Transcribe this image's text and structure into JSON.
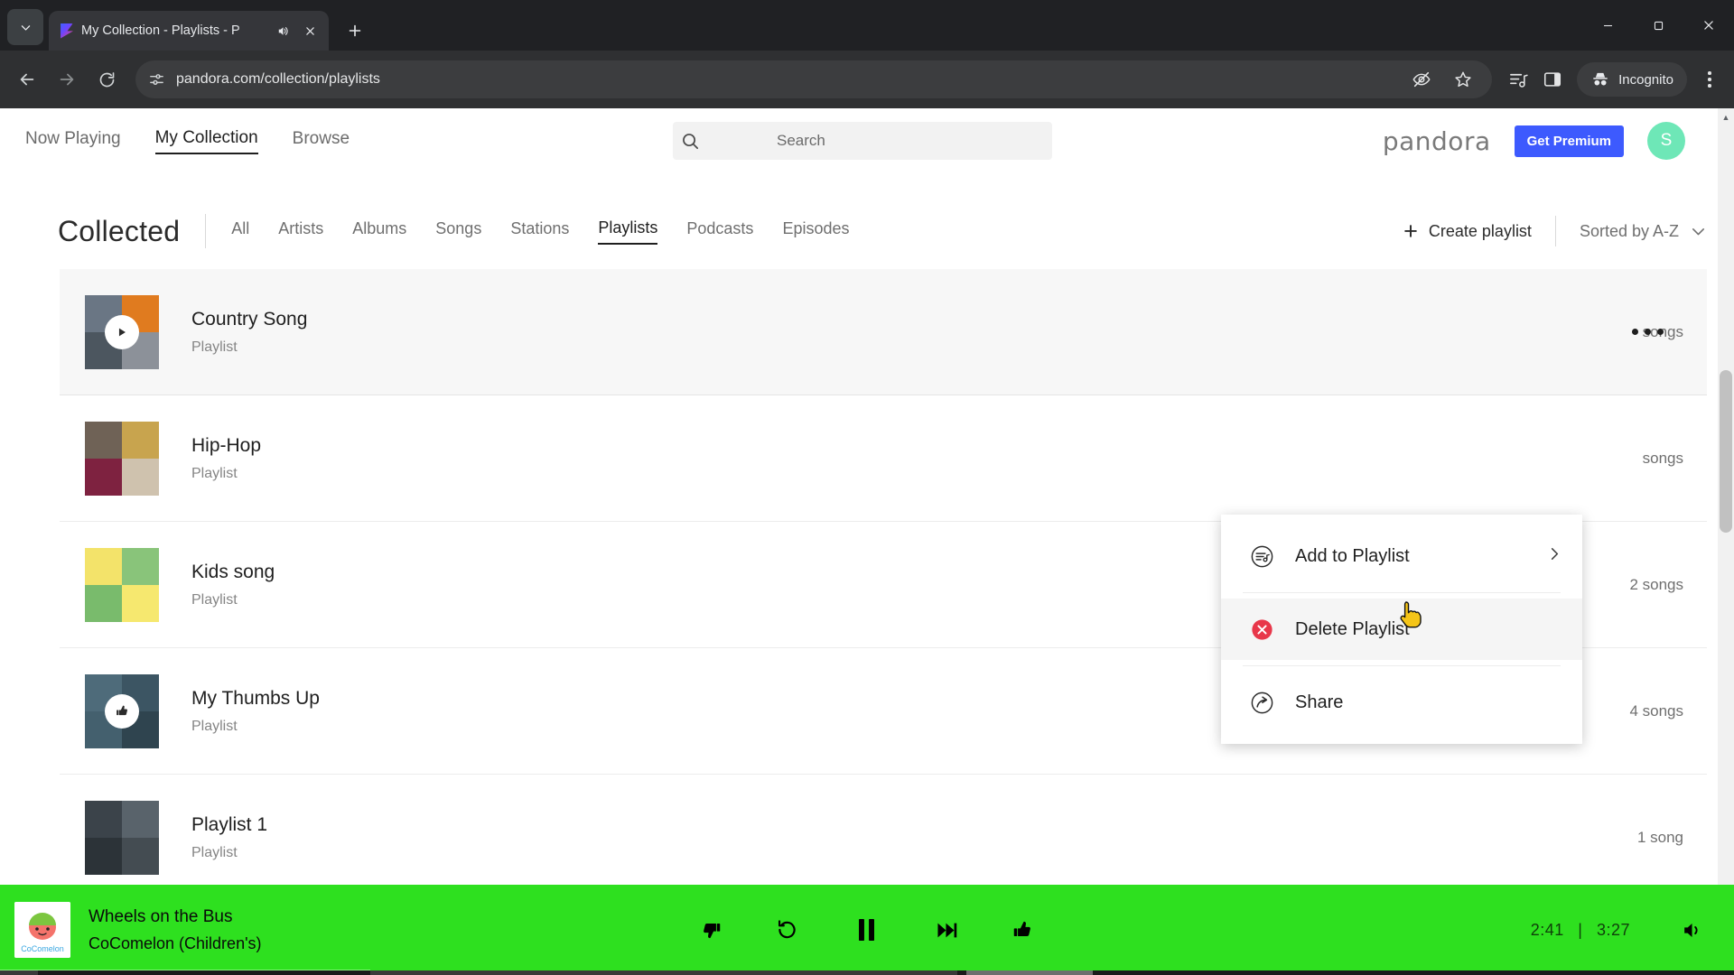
{
  "browser": {
    "tab": {
      "title": "My Collection - Playlists - P",
      "audio_icon": "speaker-icon",
      "close_icon": "close-icon"
    },
    "tab_list_icon": "chevron-down-icon",
    "new_tab_icon": "plus-icon",
    "window_controls": {
      "minimize": "minimize-icon",
      "maximize": "maximize-icon",
      "close": "close-icon"
    },
    "nav": {
      "back": "back-arrow-icon",
      "forward": "forward-arrow-icon",
      "reload": "reload-icon"
    },
    "omnibox": {
      "site_info_icon": "page-info-icon",
      "url": "pandora.com/collection/playlists"
    },
    "toolbar_icons": [
      "eye-off-icon",
      "star-icon",
      "media-list-icon",
      "side-panel-icon"
    ],
    "incognito": {
      "label": "Incognito",
      "icon": "incognito-hat-icon"
    },
    "menu_icon": "three-dots-vertical-icon"
  },
  "header": {
    "nav_links": [
      {
        "label": "Now Playing",
        "active": false
      },
      {
        "label": "My Collection",
        "active": true
      },
      {
        "label": "Browse",
        "active": false
      }
    ],
    "search": {
      "placeholder": "Search",
      "value": "",
      "icon": "search-icon"
    },
    "brand": "pandora",
    "premium_button": "Get Premium",
    "premium_color": "#3d5afe",
    "avatar_letter": "S",
    "avatar_color": "#6ee7b7"
  },
  "collected": {
    "title": "Collected",
    "filters": [
      {
        "label": "All",
        "active": false
      },
      {
        "label": "Artists",
        "active": false
      },
      {
        "label": "Albums",
        "active": false
      },
      {
        "label": "Songs",
        "active": false
      },
      {
        "label": "Stations",
        "active": false
      },
      {
        "label": "Playlists",
        "active": true
      },
      {
        "label": "Podcasts",
        "active": false
      },
      {
        "label": "Episodes",
        "active": false
      }
    ],
    "create_playlist": {
      "label": "Create playlist",
      "icon": "plus-icon"
    },
    "sort": {
      "label": "Sorted by A-Z",
      "icon": "chevron-down-icon"
    }
  },
  "playlists": [
    {
      "title": "Country Song",
      "subtitle": "Playlist",
      "count": "songs",
      "selected": true,
      "overlay": "play-icon",
      "art_colors": [
        "#5b6b7a",
        "#7e8b96",
        "#e07b1f",
        "#3d4750"
      ]
    },
    {
      "title": "Hip-Hop",
      "subtitle": "Playlist",
      "count": "songs",
      "selected": false,
      "overlay": "",
      "art_colors": [
        "#6f6256",
        "#c8a44e",
        "#7e2240",
        "#cfc2ae"
      ]
    },
    {
      "title": "Kids song",
      "subtitle": "Playlist",
      "count": "2 songs",
      "selected": false,
      "overlay": "",
      "art_colors": [
        "#f3e36a",
        "#89c47a",
        "#79bb6c",
        "#f6e86f"
      ]
    },
    {
      "title": "My Thumbs Up",
      "subtitle": "Playlist",
      "count": "4 songs",
      "selected": false,
      "overlay": "thumbs-up-icon",
      "art_colors": [
        "#4e6b7a",
        "#3c5563",
        "#44606e",
        "#2f444f"
      ]
    },
    {
      "title": "Playlist 1",
      "subtitle": "Playlist",
      "count": "1 song",
      "selected": false,
      "overlay": "",
      "art_colors": [
        "#3b434a",
        "#59636b",
        "#2c3338",
        "#444c52"
      ]
    }
  ],
  "row_more_icon": "three-dots-horizontal-icon",
  "context_menu": {
    "items": [
      {
        "label": "Add to Playlist",
        "icon": "playlist-add-icon",
        "chevron": "›",
        "hover": false
      },
      {
        "label": "Delete Playlist",
        "icon": "delete-circle-icon",
        "chevron": "",
        "hover": true
      },
      {
        "label": "Share",
        "icon": "share-icon",
        "chevron": "",
        "hover": false
      }
    ],
    "delete_icon_color": "#e8374a"
  },
  "player": {
    "background": "#2ee01f",
    "track": "Wheels on the Bus",
    "artist": "CoComelon (Children's)",
    "controls": [
      "thumbs-down-icon",
      "replay-icon",
      "pause-icon",
      "skip-next-icon",
      "thumbs-up-icon"
    ],
    "elapsed": "2:41",
    "separator": "|",
    "duration": "3:27",
    "volume_icon": "volume-icon",
    "album_art_label": "CoComelon"
  }
}
